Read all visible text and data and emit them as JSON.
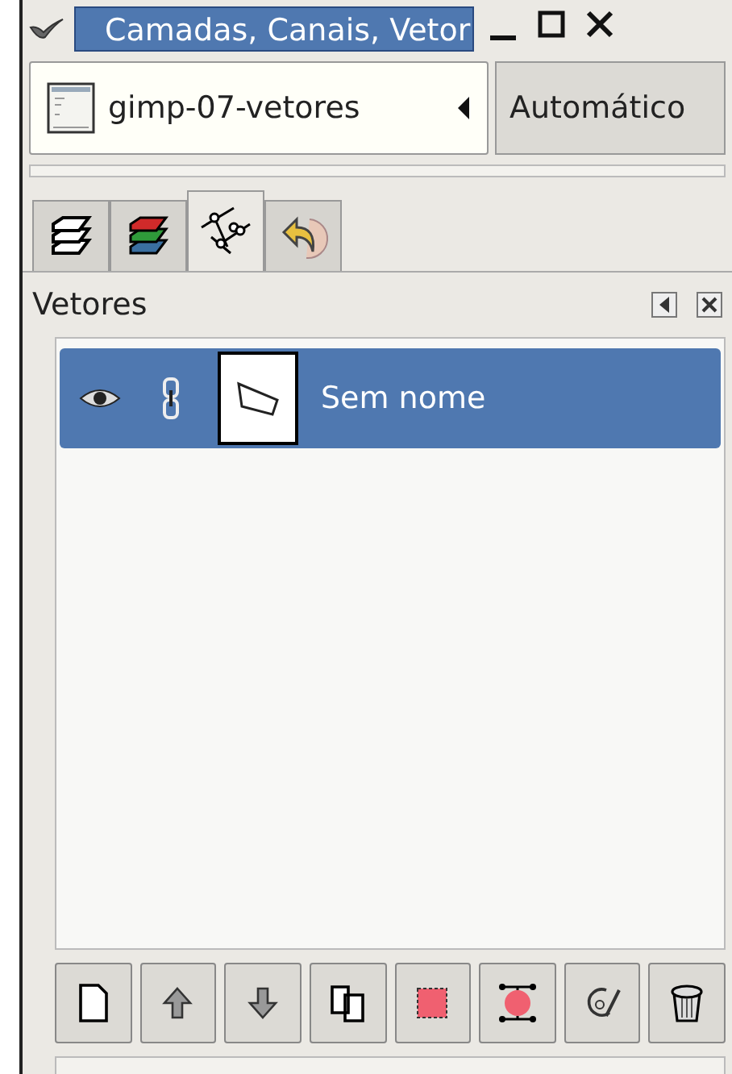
{
  "window": {
    "title": "Camadas, Canais, Vetor"
  },
  "image_selector": {
    "image": "gimp-07-vetores",
    "mode": "Automático"
  },
  "tabs": [
    {
      "kind": "layers",
      "selected": false
    },
    {
      "kind": "channels",
      "selected": false
    },
    {
      "kind": "paths",
      "selected": true
    },
    {
      "kind": "undo",
      "selected": false
    }
  ],
  "panel": {
    "title": "Vetores"
  },
  "paths": [
    {
      "name": "Sem nome",
      "visible": true,
      "linked": true,
      "selected": true
    }
  ],
  "buttons": [
    {
      "kind": "new"
    },
    {
      "kind": "raise"
    },
    {
      "kind": "lower"
    },
    {
      "kind": "duplicate"
    },
    {
      "kind": "to-selection"
    },
    {
      "kind": "from-selection"
    },
    {
      "kind": "paint"
    },
    {
      "kind": "delete"
    }
  ]
}
